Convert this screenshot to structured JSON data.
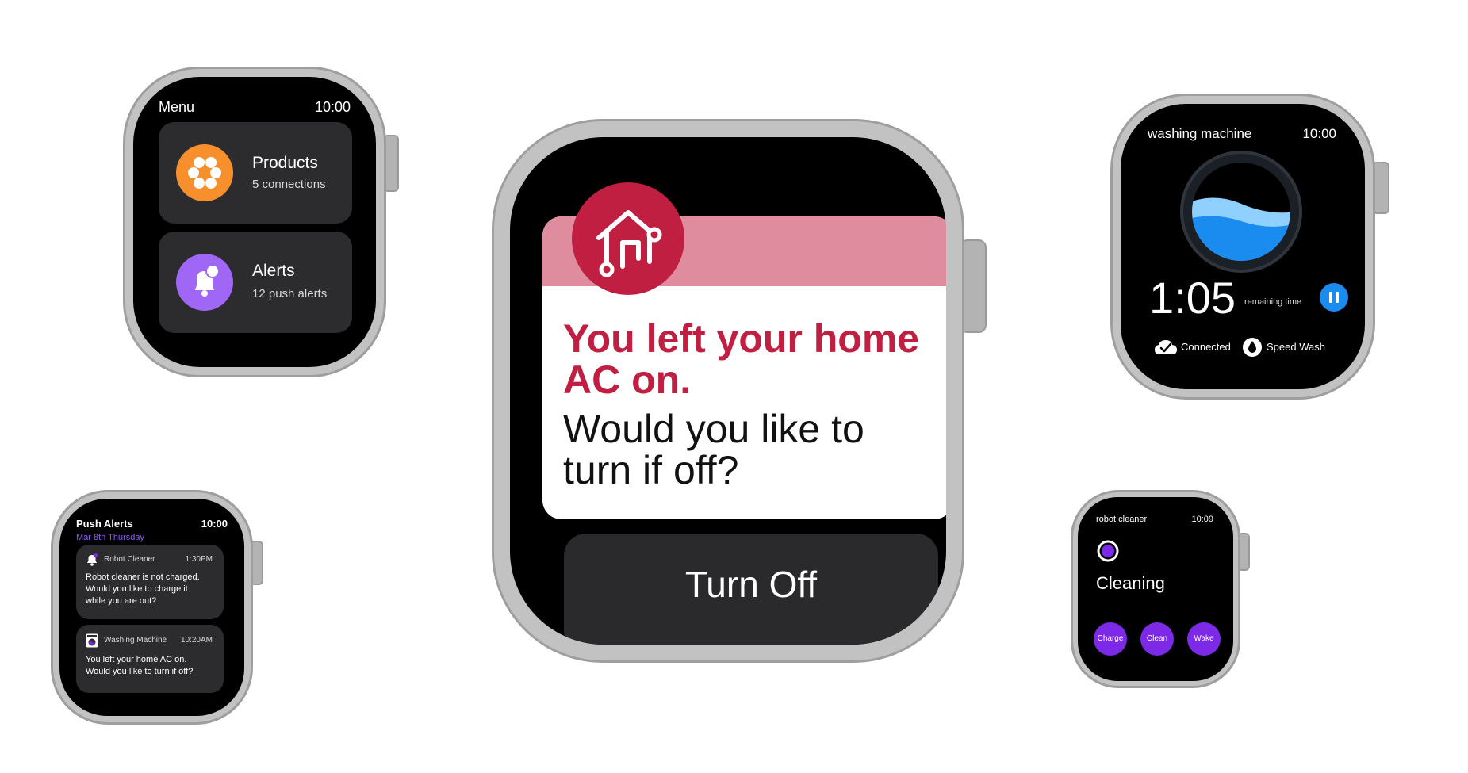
{
  "colors": {
    "case": "#c2c2c2",
    "screen": "#000000",
    "card": "#2c2c2e",
    "accent_purple": "#7c2ae8",
    "accent_orange": "#f7902c",
    "alert_purple": "#a066f5",
    "notify_red": "#c01f41",
    "notify_band": "#de8c9e",
    "timer_blue": "#1a8cf0"
  },
  "menu_watch": {
    "title": "Menu",
    "time": "10:00",
    "items": [
      {
        "icon": "products-dots-icon",
        "label": "Products",
        "sublabel": "5 connections"
      },
      {
        "icon": "bell-icon",
        "label": "Alerts",
        "sublabel": "12 push alerts"
      }
    ]
  },
  "alerts_watch": {
    "title": "Push Alerts",
    "time": "10:00",
    "date": "Mar 8th Thursday",
    "notifications": [
      {
        "icon": "bell-icon",
        "app": "Robot Cleaner",
        "time": "1:30PM",
        "lines": [
          "Robot cleaner is not charged.",
          "Would you like to charge it",
          "while you are out?"
        ]
      },
      {
        "icon": "washing-machine-icon",
        "app": "Washing Machine",
        "time": "10:20AM",
        "lines": [
          "You left your home AC on.",
          "Would you like to turn if off?"
        ]
      }
    ]
  },
  "notify_watch": {
    "icon": "smart-home-icon",
    "headline_lines": [
      "You left your home",
      "AC on."
    ],
    "question_lines": [
      "Would you like to",
      "turn if off?"
    ],
    "button_label": "Turn Off"
  },
  "wash_watch": {
    "title": "washing machine",
    "time": "10:00",
    "remaining": "1:05",
    "remaining_label": "remaining time",
    "status": [
      {
        "icon": "cloud-check-icon",
        "label": "Connected"
      },
      {
        "icon": "water-drop-icon",
        "label": "Speed Wash"
      }
    ]
  },
  "robot_watch": {
    "title": "robot cleaner",
    "time": "10:09",
    "status": "Cleaning",
    "buttons": [
      "Charge",
      "Clean",
      "Wake"
    ]
  }
}
